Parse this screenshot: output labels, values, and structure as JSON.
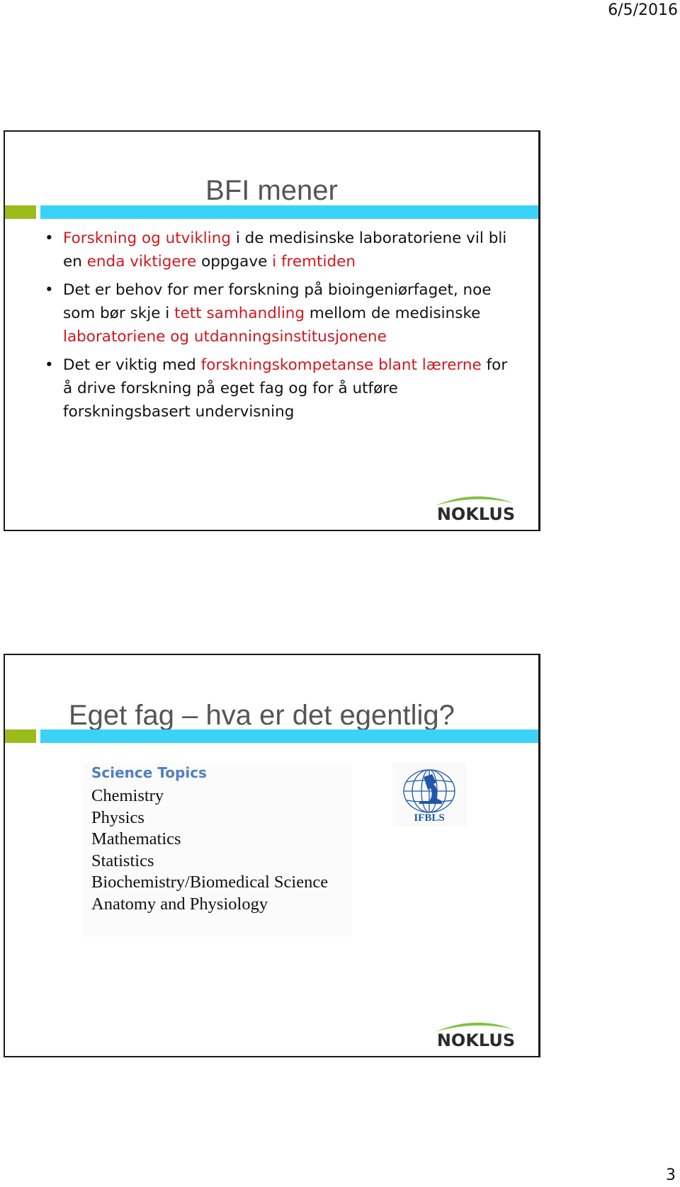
{
  "header": {
    "date": "6/5/2016"
  },
  "footer": {
    "page_number": "3"
  },
  "slides": [
    {
      "title": "BFI mener",
      "bullets": [
        {
          "segments": [
            {
              "text": "Forskning og utvikling",
              "highlight": true
            },
            {
              "text": " i de medisinske laboratoriene vil bli en ",
              "highlight": false
            },
            {
              "text": "enda viktigere",
              "highlight": true
            },
            {
              "text": " oppgave ",
              "highlight": false
            },
            {
              "text": "i fremtiden",
              "highlight": true
            }
          ]
        },
        {
          "segments": [
            {
              "text": "Det er behov for mer forskning på bioingeniørfaget, noe som bør skje i ",
              "highlight": false
            },
            {
              "text": "tett samhandling",
              "highlight": true
            },
            {
              "text": " mellom de medisinske ",
              "highlight": false
            },
            {
              "text": "laboratoriene og utdanningsinstitusjonene",
              "highlight": true
            }
          ]
        },
        {
          "segments": [
            {
              "text": "Det er viktig med ",
              "highlight": false
            },
            {
              "text": "forskningskompetanse blant lærerne",
              "highlight": true
            },
            {
              "text": " for å drive forskning på eget fag og for å utføre forskningsbasert undervisning",
              "highlight": false
            }
          ]
        }
      ],
      "logo": {
        "text": "NOKLUS",
        "icon": "noklus-logo"
      }
    },
    {
      "title": "Eget fag – hva er det egentlig?",
      "topics": {
        "heading": "Science Topics",
        "items": [
          "Chemistry",
          "Physics",
          "Mathematics",
          "Statistics",
          "Biochemistry/Biomedical Science",
          "Anatomy and Physiology"
        ]
      },
      "emblem": {
        "text": "IFBLS",
        "icon": "ifbls-logo"
      },
      "logo": {
        "text": "NOKLUS",
        "icon": "noklus-logo"
      }
    }
  ],
  "colors": {
    "accent_green": "#9cbb1c",
    "accent_cyan": "#3bd2f8",
    "highlight_red": "#d0181f",
    "topics_heading_blue": "#4f81bd",
    "title_gray": "#555555"
  }
}
